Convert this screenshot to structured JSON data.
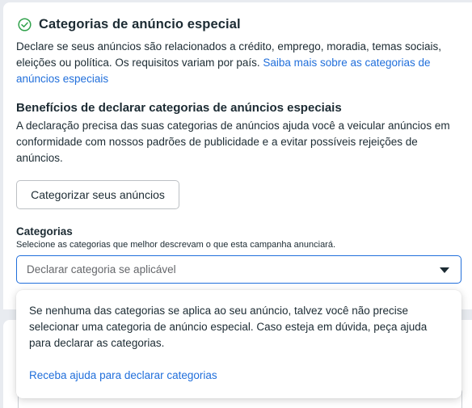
{
  "section": {
    "title": "Categorias de anúncio especial",
    "description_text": "Declare se seus anúncios são relacionados a crédito, emprego, moradia, temas sociais, eleições ou política. Os requisitos variam por país. ",
    "learn_more_link": "Saiba mais sobre as categorias de anúncios especiais",
    "check_icon": "circle-check-icon"
  },
  "benefits": {
    "title": "Benefícios de declarar categorias de anúncios especiais",
    "text": "A declaração precisa das suas categorias de anúncios ajuda você a veicular anúncios em conformidade com nossos padrões de publicidade e a evitar possíveis rejeições de anúncios."
  },
  "categorize_button": {
    "label": "Categorizar seus anúncios"
  },
  "categories": {
    "label": "Categorias",
    "help": "Selecione as categorias que melhor descrevam o que esta campanha anunciará.",
    "placeholder": "Declarar categoria se aplicável",
    "caret_icon": "caret-down-icon"
  },
  "popover": {
    "text": "Se nenhuma das categorias se aplica ao seu anúncio, talvez você não precise selecionar uma categoria de anúncio especial. Caso esteja em dúvida, peça ajuda para declarar as categorias.",
    "link": "Receba ajuda para declarar categorias"
  },
  "colors": {
    "accent": "#216fdb",
    "text": "#1c2b33",
    "check_green": "#31a24c"
  }
}
